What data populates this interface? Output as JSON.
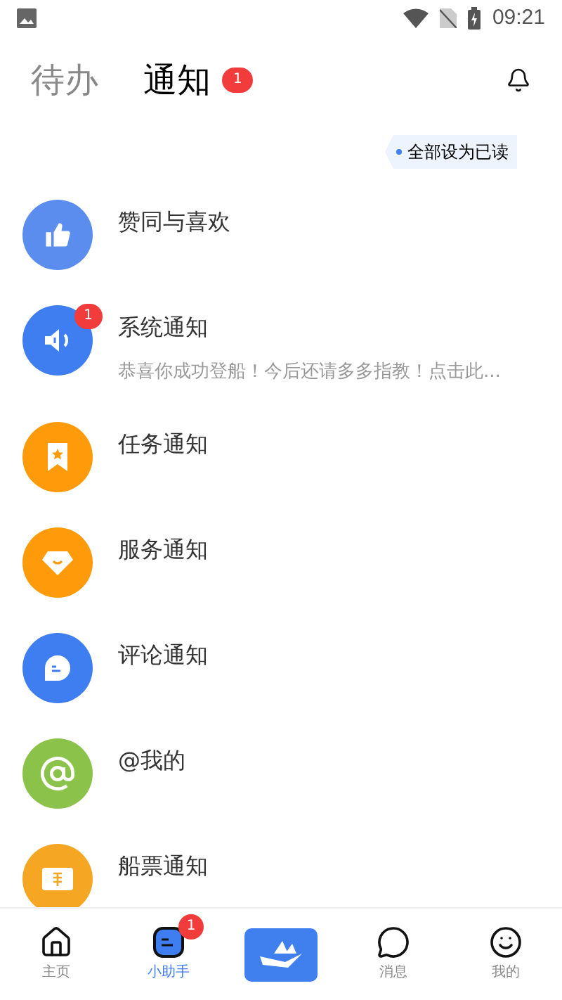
{
  "status_bar": {
    "time": "09:21"
  },
  "tabs": [
    {
      "label": "待办",
      "selected": false
    },
    {
      "label": "通知",
      "selected": true,
      "badge": "1"
    }
  ],
  "mark_all_read": "全部设为已读",
  "notifications": [
    {
      "kind": "like",
      "color": "#5b8def",
      "title": "赞同与喜欢"
    },
    {
      "kind": "speaker",
      "color": "#3f7ef0",
      "title": "系统通知",
      "badge": "1",
      "preview": "恭喜你成功登船！今后还请多多指教！点击此..."
    },
    {
      "kind": "bookmark",
      "color": "#ff9a0a",
      "title": "任务通知"
    },
    {
      "kind": "diamond",
      "color": "#ff9a0a",
      "title": "服务通知"
    },
    {
      "kind": "comment",
      "color": "#3f7ef0",
      "title": "评论通知"
    },
    {
      "kind": "at",
      "color": "#8bc34a",
      "title": "@我的"
    },
    {
      "kind": "ticket",
      "color": "#f5a623",
      "title": "船票通知"
    }
  ],
  "bottom_nav": [
    {
      "kind": "home",
      "label": "主页",
      "selected": false
    },
    {
      "kind": "assistant",
      "label": "小助手",
      "selected": true,
      "badge": "1"
    },
    {
      "kind": "center",
      "selected": false
    },
    {
      "kind": "messages",
      "label": "消息",
      "selected": false
    },
    {
      "kind": "profile",
      "label": "我的",
      "selected": false
    }
  ]
}
